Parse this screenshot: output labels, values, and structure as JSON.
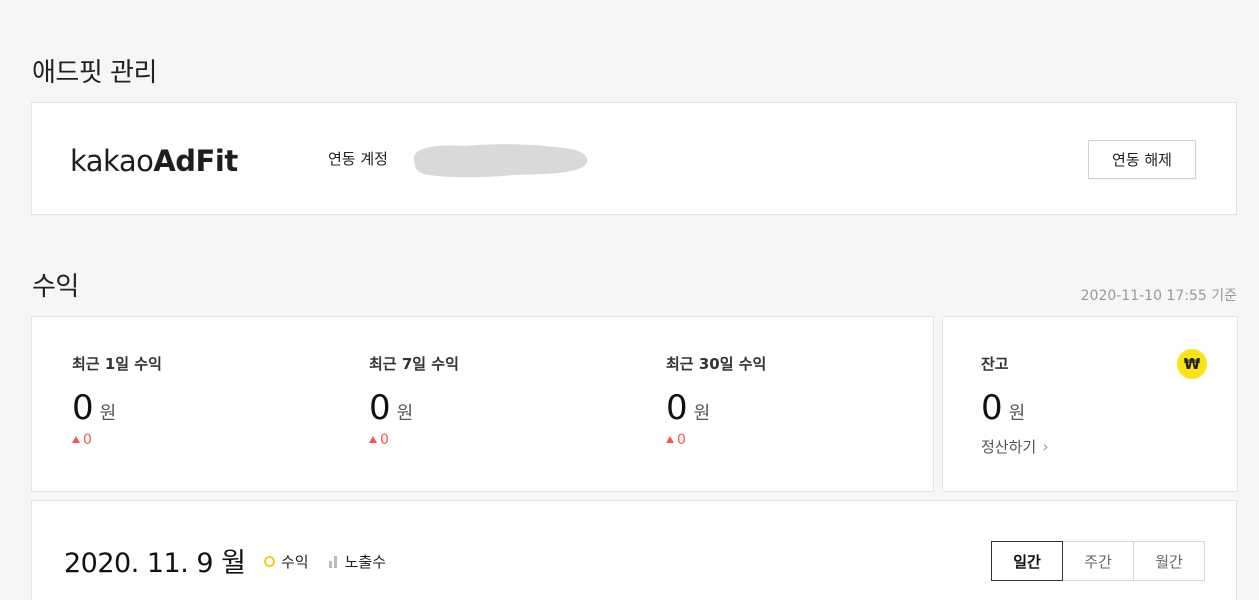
{
  "adfit": {
    "title": "애드핏 관리",
    "logo": {
      "light": "kakao",
      "bold": "AdFit"
    },
    "linked_account_label": "연동 계정",
    "unlink_button": "연동 해제"
  },
  "revenue": {
    "title": "수익",
    "basis_time": "2020-11-10 17:55 기준",
    "stats": [
      {
        "label": "최근 1일 수익",
        "value": "0",
        "unit": "원",
        "delta": "0"
      },
      {
        "label": "최근 7일 수익",
        "value": "0",
        "unit": "원",
        "delta": "0"
      },
      {
        "label": "최근 30일 수익",
        "value": "0",
        "unit": "원",
        "delta": "0"
      }
    ],
    "balance": {
      "label": "잔고",
      "value": "0",
      "unit": "원",
      "settle_link": "정산하기",
      "icon": "won-coin-icon",
      "icon_glyph": "₩"
    }
  },
  "chart": {
    "date": "2020. 11. 9",
    "weekday": "월",
    "legend": [
      {
        "label": "수익",
        "icon": "circle-icon",
        "color": "#f0cf1a"
      },
      {
        "label": "노출수",
        "icon": "bar-icon",
        "color": "#b8bcc2"
      }
    ],
    "tabs": [
      {
        "label": "일간",
        "active": true
      },
      {
        "label": "주간",
        "active": false
      },
      {
        "label": "월간",
        "active": false
      }
    ]
  },
  "colors": {
    "background": "#f5f6f7",
    "accent_yellow": "#fde21a",
    "delta_red": "#f05a4f"
  }
}
